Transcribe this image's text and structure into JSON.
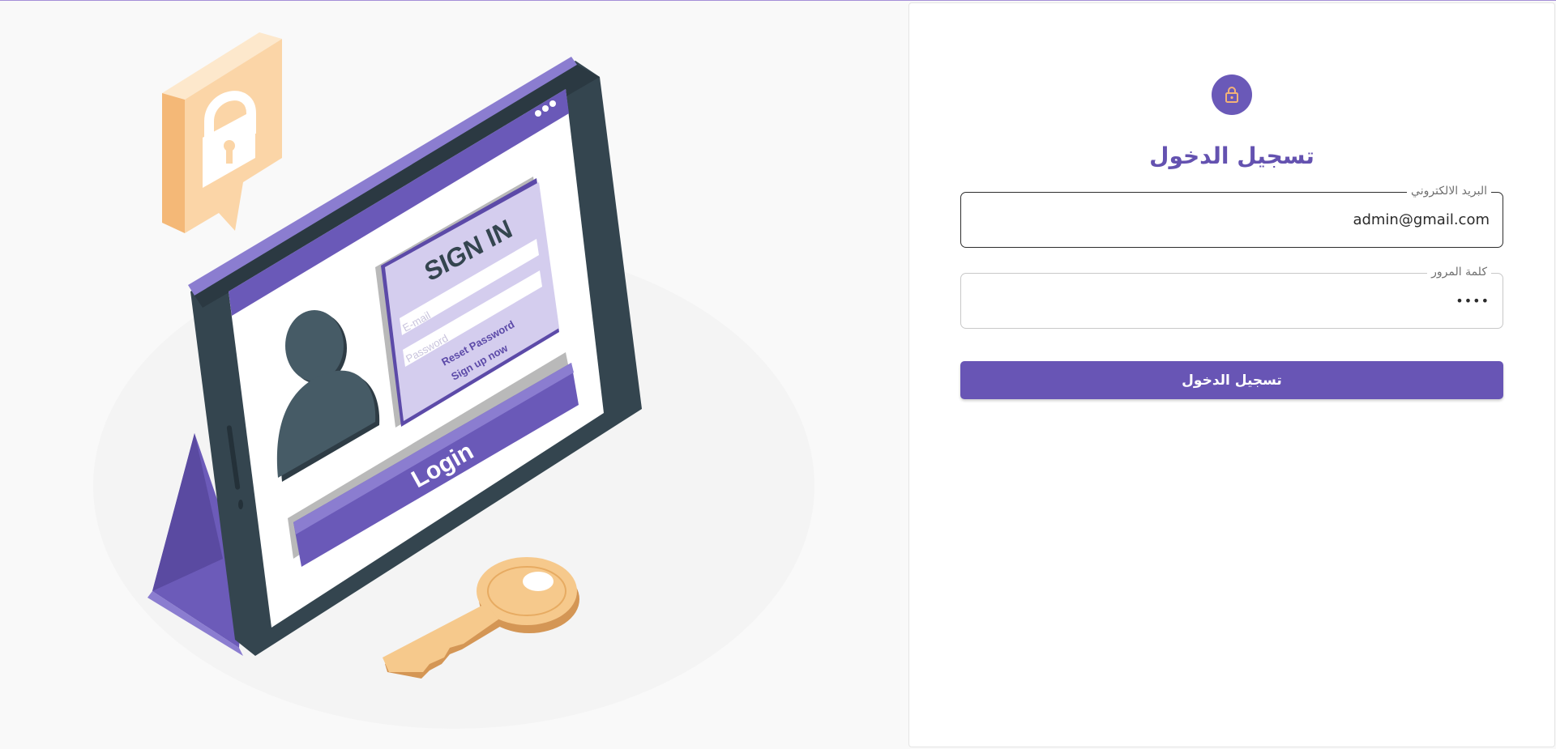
{
  "form": {
    "title": "تسجيل الدخول",
    "email": {
      "label": "البريد الالكتروني",
      "value": "admin@gmail.com"
    },
    "password": {
      "label": "كلمة المرور",
      "value": "1234"
    },
    "submit_label": "تسجيل الدخول"
  },
  "illustration": {
    "sign_in_heading": "SIGN IN",
    "email_placeholder": "E-mail",
    "password_placeholder": "Password",
    "reset_password": "Reset Password",
    "sign_up": "Sign up now",
    "login_label": "Login"
  },
  "icons": {
    "avatar_icon": "lock-icon",
    "illustration_badge_icon": "padlock-icon",
    "illustration_key_icon": "key-icon",
    "illustration_user_icon": "user-icon"
  },
  "colors": {
    "primary": "#6855b5",
    "lock_accent": "#f3b277",
    "tablet_frame": "#34454f",
    "background": "#f9f9f9"
  }
}
